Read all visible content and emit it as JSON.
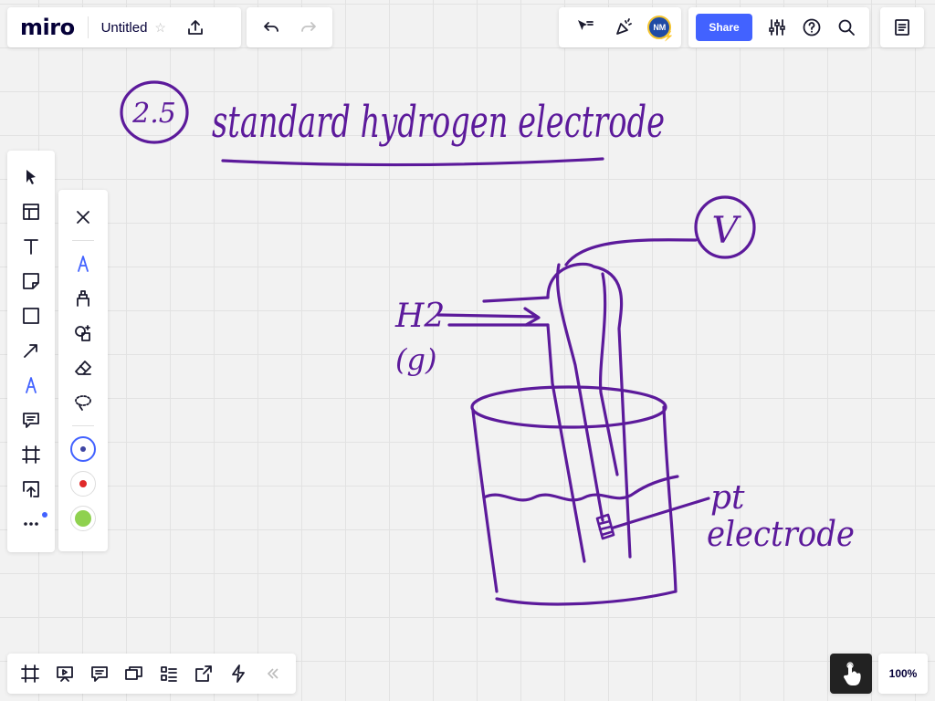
{
  "app": {
    "logo": "miro",
    "board_title": "Untitled",
    "share_label": "Share",
    "zoom_level": "100%"
  },
  "colors": {
    "accent": "#4262ff",
    "ink": "#5c1a9b",
    "pen_red": "#e02929",
    "pen_green": "#8fd14f"
  },
  "toolbar_top_left": [
    "star-icon",
    "export-icon"
  ],
  "toolbar_undo": [
    "undo-icon",
    "redo-icon"
  ],
  "toolbar_collab": {
    "icons": [
      "cursor-filter-icon",
      "celebrate-icon"
    ],
    "avatar_initials": "NM"
  },
  "toolbar_right": [
    "settings-sliders-icon",
    "help-icon",
    "search-icon"
  ],
  "left_tools": [
    "select-icon",
    "templates-icon",
    "text-icon",
    "sticky-note-icon",
    "shape-icon",
    "arrow-icon",
    "pen-icon",
    "comment-icon",
    "frame-icon",
    "upload-icon",
    "more-icon"
  ],
  "pen_tools": [
    "close-icon",
    "pen-icon",
    "highlighter-icon",
    "smart-drawing-icon",
    "eraser-icon",
    "lasso-icon"
  ],
  "pen_colors": [
    "#3e45a3",
    "#e02929",
    "#8fd14f"
  ],
  "bottom_tools": [
    "frames-icon",
    "presentation-icon",
    "comments-icon",
    "video-chat-icon",
    "card-list-icon",
    "share-screen-icon",
    "lightning-icon",
    "collapse-icon"
  ],
  "drawing": {
    "number": "2.5",
    "title": "standard hydrogen electrode",
    "gas_label": "H2",
    "gas_state": "(g)",
    "voltmeter": "V",
    "electrode_label_1": "pt",
    "electrode_label_2": "electrode"
  }
}
